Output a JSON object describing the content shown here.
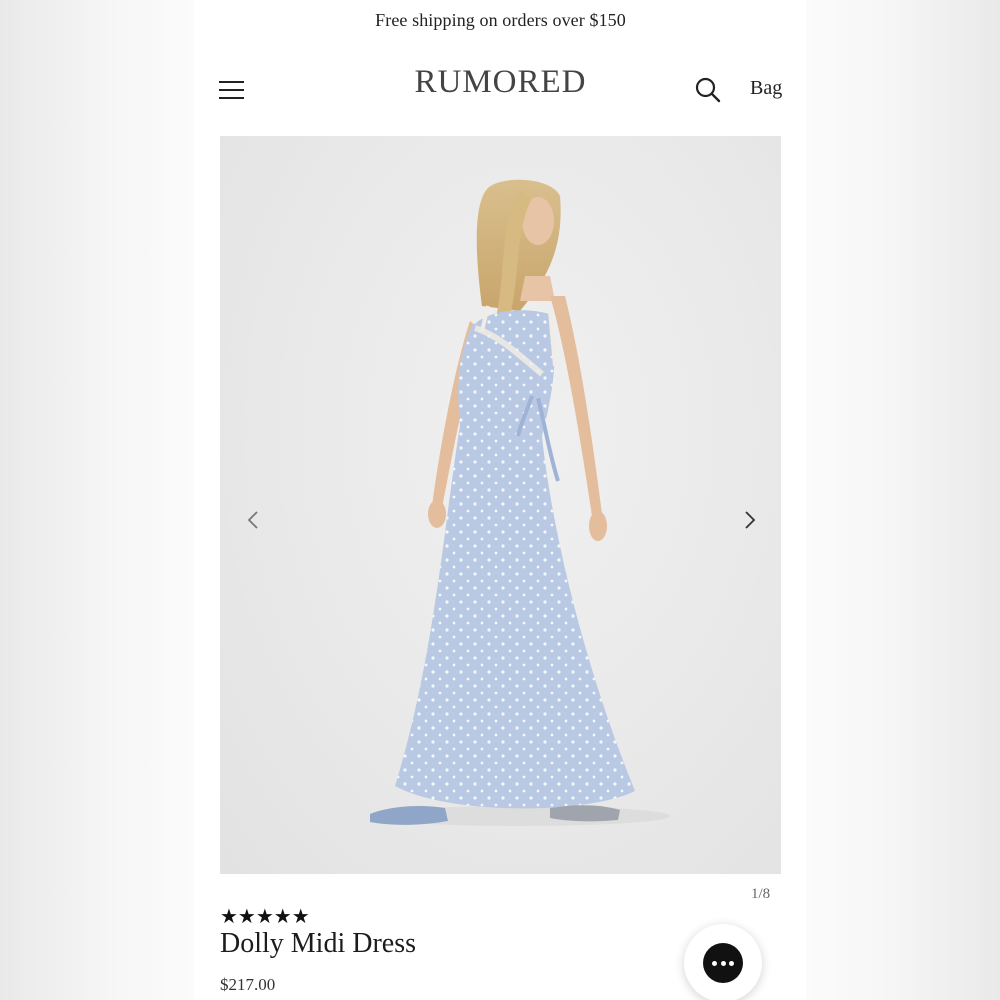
{
  "announcement": "Free shipping on orders over $150",
  "header": {
    "menu_icon": "hamburger-menu-icon",
    "logo": "RUMORED",
    "search_icon": "search-icon",
    "bag_label": "Bag"
  },
  "gallery": {
    "image_subject": "model in light blue polka dot maxi dress",
    "prev_icon": "chevron-left-icon",
    "next_icon": "chevron-right-icon",
    "counter": "1/8"
  },
  "product": {
    "rating_display": "★★★★★",
    "rating": 5,
    "title": "Dolly Midi Dress",
    "price": "$217.00"
  },
  "chat": {
    "icon": "chat-bubble-icon"
  },
  "colors": {
    "dress": "#b9c9e3",
    "text": "#1b1b1b",
    "chat_bubble": "#111111"
  }
}
